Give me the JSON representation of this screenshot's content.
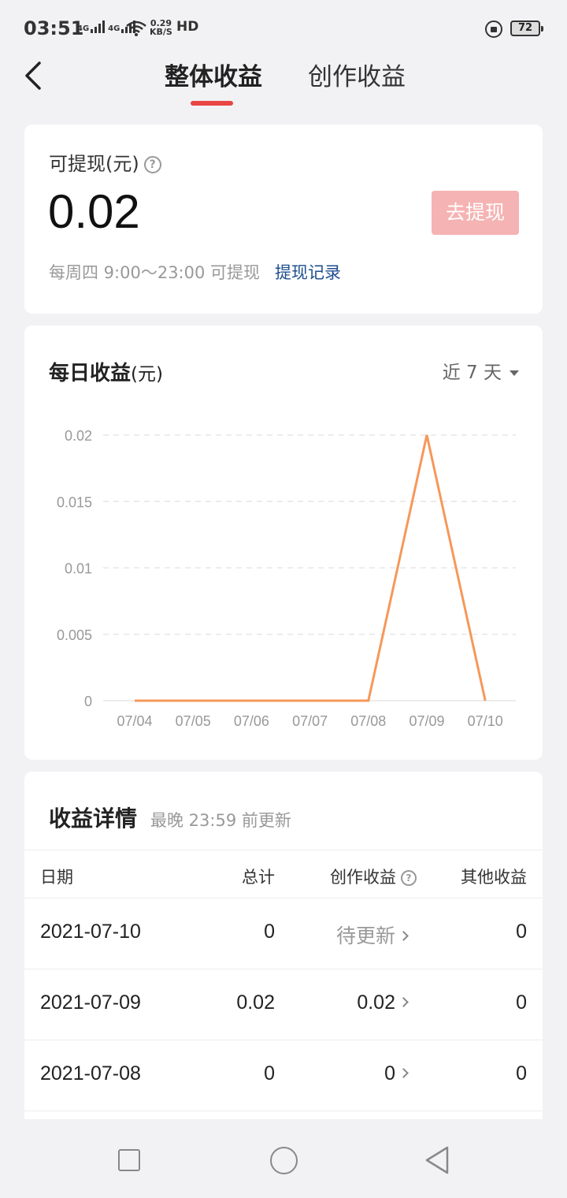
{
  "status_bar": {
    "time": "03:51",
    "network1": "4G",
    "network2": "4G",
    "speed_value": "0.29",
    "speed_unit": "KB/S",
    "hd": "HD",
    "battery": "72"
  },
  "header": {
    "tabs": [
      {
        "label": "整体收益",
        "active": true
      },
      {
        "label": "创作收益",
        "active": false
      }
    ],
    "accent_color": "#e94545"
  },
  "withdraw": {
    "label": "可提现(元)",
    "amount": "0.02",
    "button": "去提现",
    "note": "每周四 9:00～23:00 可提现",
    "record_link": "提现记录"
  },
  "daily": {
    "title": "每日收益",
    "unit": "(元)",
    "range": "近 7 天"
  },
  "chart_data": {
    "type": "line",
    "title": "每日收益(元)",
    "x": [
      "07/04",
      "07/05",
      "07/06",
      "07/07",
      "07/08",
      "07/09",
      "07/10"
    ],
    "series": [
      {
        "values": [
          0,
          0,
          0,
          0,
          0,
          0.02,
          0
        ],
        "color": "#f5985a"
      }
    ],
    "yticks": [
      "0",
      "0.005",
      "0.01",
      "0.015",
      "0.02"
    ],
    "ylim": [
      0,
      0.02
    ],
    "grid": true,
    "grid_style": "dashed"
  },
  "details": {
    "title": "收益详情",
    "subtitle": "最晚 23:59 前更新",
    "columns": [
      "日期",
      "总计",
      "创作收益",
      "其他收益"
    ],
    "rows": [
      {
        "date": "2021-07-10",
        "total": "0",
        "creation": "待更新",
        "other": "0",
        "pending": true
      },
      {
        "date": "2021-07-09",
        "total": "0.02",
        "creation": "0.02",
        "other": "0",
        "pending": false
      },
      {
        "date": "2021-07-08",
        "total": "0",
        "creation": "0",
        "other": "0",
        "pending": false
      }
    ]
  }
}
